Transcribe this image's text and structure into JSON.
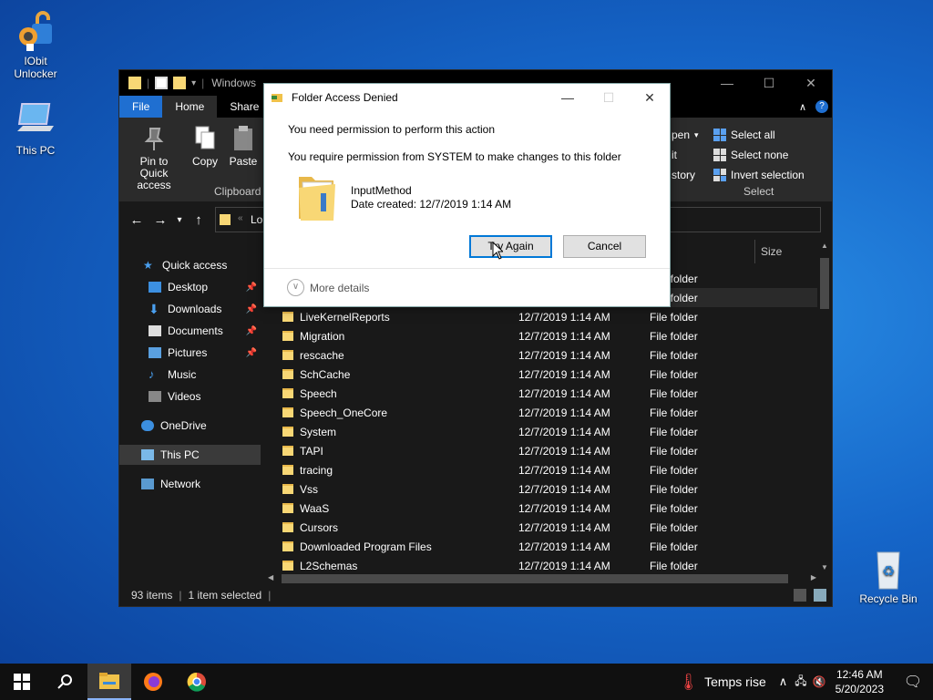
{
  "desktop": {
    "icons": [
      {
        "label_line1": "IObit",
        "label_line2": "Unlocker",
        "icon": "iobit-unlocker-icon"
      },
      {
        "label_line1": "This PC",
        "label_line2": "",
        "icon": "computer-icon"
      },
      {
        "label_line1": "Recycle Bin",
        "label_line2": "",
        "icon": "recycle-bin-icon"
      }
    ]
  },
  "explorer": {
    "title": "Windows",
    "tabs": {
      "file": "File",
      "home": "Home",
      "share": "Share"
    },
    "ribbon": {
      "pin_line1": "Pin to Quick",
      "pin_line2": "access",
      "copy": "Copy",
      "paste": "Paste",
      "clipboard_group": "Clipboard",
      "open_partial": "pen",
      "edit_partial": "it",
      "history_partial": "story",
      "select_all": "Select all",
      "select_none": "Select none",
      "invert_selection": "Invert selection",
      "select_group": "Select"
    },
    "address_partial": "Lo",
    "column_size": "Size",
    "sidebar": {
      "quick_access": "Quick access",
      "desktop": "Desktop",
      "downloads": "Downloads",
      "documents": "Documents",
      "pictures": "Pictures",
      "music": "Music",
      "videos": "Videos",
      "onedrive": "OneDrive",
      "this_pc": "This PC",
      "network": "Network"
    },
    "files": [
      {
        "name": "",
        "date": "",
        "type": "File folder"
      },
      {
        "name": "",
        "date": "",
        "type": "File folder"
      },
      {
        "name": "LiveKernelReports",
        "date": "12/7/2019 1:14 AM",
        "type": "File folder"
      },
      {
        "name": "Migration",
        "date": "12/7/2019 1:14 AM",
        "type": "File folder"
      },
      {
        "name": "rescache",
        "date": "12/7/2019 1:14 AM",
        "type": "File folder"
      },
      {
        "name": "SchCache",
        "date": "12/7/2019 1:14 AM",
        "type": "File folder"
      },
      {
        "name": "Speech",
        "date": "12/7/2019 1:14 AM",
        "type": "File folder"
      },
      {
        "name": "Speech_OneCore",
        "date": "12/7/2019 1:14 AM",
        "type": "File folder"
      },
      {
        "name": "System",
        "date": "12/7/2019 1:14 AM",
        "type": "File folder"
      },
      {
        "name": "TAPI",
        "date": "12/7/2019 1:14 AM",
        "type": "File folder"
      },
      {
        "name": "tracing",
        "date": "12/7/2019 1:14 AM",
        "type": "File folder"
      },
      {
        "name": "Vss",
        "date": "12/7/2019 1:14 AM",
        "type": "File folder"
      },
      {
        "name": "WaaS",
        "date": "12/7/2019 1:14 AM",
        "type": "File folder"
      },
      {
        "name": "Cursors",
        "date": "12/7/2019 1:14 AM",
        "type": "File folder"
      },
      {
        "name": "Downloaded Program Files",
        "date": "12/7/2019 1:14 AM",
        "type": "File folder"
      },
      {
        "name": "L2Schemas",
        "date": "12/7/2019 1:14 AM",
        "type": "File folder"
      }
    ],
    "status": {
      "count": "93 items",
      "selected": "1 item selected"
    }
  },
  "dialog": {
    "title": "Folder Access Denied",
    "heading": "You need permission to perform this action",
    "message": "You require permission from SYSTEM to make changes to this folder",
    "folder_name": "InputMethod",
    "date_created": "Date created: 12/7/2019 1:14 AM",
    "try_again": "Try Again",
    "cancel": "Cancel",
    "more_details": "More details"
  },
  "taskbar": {
    "weather": "Temps rise",
    "time": "12:46 AM",
    "date": "5/20/2023"
  },
  "colors": {
    "accent": "#1f6fd1",
    "folder": "#f8d775"
  }
}
